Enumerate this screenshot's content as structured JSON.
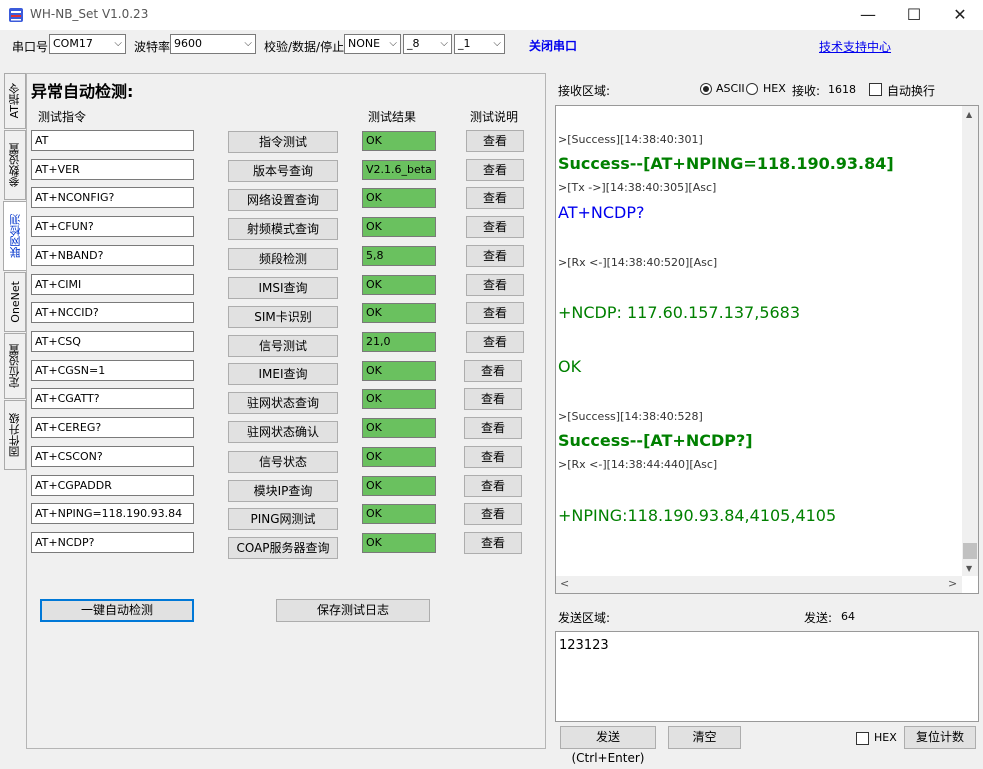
{
  "window": {
    "title": "WH-NB_Set V1.0.23",
    "minimize": "—",
    "maximize": "☐",
    "close": "✕"
  },
  "toolbar": {
    "port_label": "串口号",
    "port_value": "COM17",
    "baud_label": "波特率",
    "baud_value": "9600",
    "parity_label": "校验/数据/停止",
    "parity_value": "NONE",
    "data_value": "_8",
    "stop_value": "_1",
    "close_port": "关闭串口",
    "support_link": "技术支持中心"
  },
  "tabs": [
    "AT指令",
    "参数设置",
    "联网检测",
    "OneNet",
    "定位设置",
    "固件升级"
  ],
  "active_tab": "联网检测",
  "panel": {
    "title": "异常自动检测:",
    "col_cmd": "测试指令",
    "col_result": "测试结果",
    "col_desc": "测试说明",
    "view_label": "查看",
    "rows": [
      {
        "cmd": "AT",
        "btn": "指令测试",
        "result": "OK"
      },
      {
        "cmd": "AT+VER",
        "btn": "版本号查询",
        "result": "V2.1.6_beta"
      },
      {
        "cmd": "AT+NCONFIG?",
        "btn": "网络设置查询",
        "result": "OK"
      },
      {
        "cmd": "AT+CFUN?",
        "btn": "射频模式查询",
        "result": "OK"
      },
      {
        "cmd": "AT+NBAND?",
        "btn": "频段检测",
        "result": "5,8"
      },
      {
        "cmd": "AT+CIMI",
        "btn": "IMSI查询",
        "result": "OK"
      },
      {
        "cmd": "AT+NCCID?",
        "btn": "SIM卡识别",
        "result": "OK"
      },
      {
        "cmd": "AT+CSQ",
        "btn": "信号测试",
        "result": "21,0"
      },
      {
        "cmd": "AT+CGSN=1",
        "btn": "IMEI查询",
        "result": "OK"
      },
      {
        "cmd": "AT+CGATT?",
        "btn": "驻网状态查询",
        "result": "OK"
      },
      {
        "cmd": "AT+CEREG?",
        "btn": "驻网状态确认",
        "result": "OK"
      },
      {
        "cmd": "AT+CSCON?",
        "btn": "信号状态",
        "result": "OK"
      },
      {
        "cmd": "AT+CGPADDR",
        "btn": "模块IP查询",
        "result": "OK"
      },
      {
        "cmd": "AT+NPING=118.190.93.84",
        "btn": "PING网测试",
        "result": "OK"
      },
      {
        "cmd": "AT+NCDP?",
        "btn": "COAP服务器查询",
        "result": "OK"
      }
    ],
    "auto_detect": "一键自动检测",
    "save_log": "保存测试日志"
  },
  "receive": {
    "label": "接收区域:",
    "ascii": "ASCII",
    "hex": "HEX",
    "count_label": "接收:",
    "count": "1618",
    "auto_wrap": "自动换行",
    "log": [
      {
        "text": ">[Success][14:38:40:301]",
        "style": "small"
      },
      {
        "text": "Success--[AT+NPING=118.190.93.84]",
        "style": "green-b"
      },
      {
        "text": ">[Tx ->][14:38:40:305][Asc]",
        "style": "small"
      },
      {
        "text": "AT+NCDP?",
        "style": "blue"
      },
      {
        "text": ">[Rx <-][14:38:40:520][Asc]",
        "style": "small"
      },
      {
        "text": "+NCDP: 117.60.157.137,5683",
        "style": "green"
      },
      {
        "text": "OK",
        "style": "green"
      },
      {
        "text": ">[Success][14:38:40:528]",
        "style": "small"
      },
      {
        "text": "Success--[AT+NCDP?]",
        "style": "green-b"
      },
      {
        "text": ">[Rx <-][14:38:44:440][Asc]",
        "style": "small"
      },
      {
        "text": "+NPING:118.190.93.84,4105,4105",
        "style": "green"
      }
    ]
  },
  "send": {
    "label": "发送区域:",
    "count_label": "发送:",
    "count": "64",
    "content": "123123",
    "send_btn": "发送(Ctrl+Enter)",
    "clear_btn": "清空",
    "hex": "HEX",
    "reset_btn": "复位计数"
  },
  "colors": {
    "result_bg": "#6ac15f",
    "link": "#0000ee",
    "success": "#008000"
  }
}
